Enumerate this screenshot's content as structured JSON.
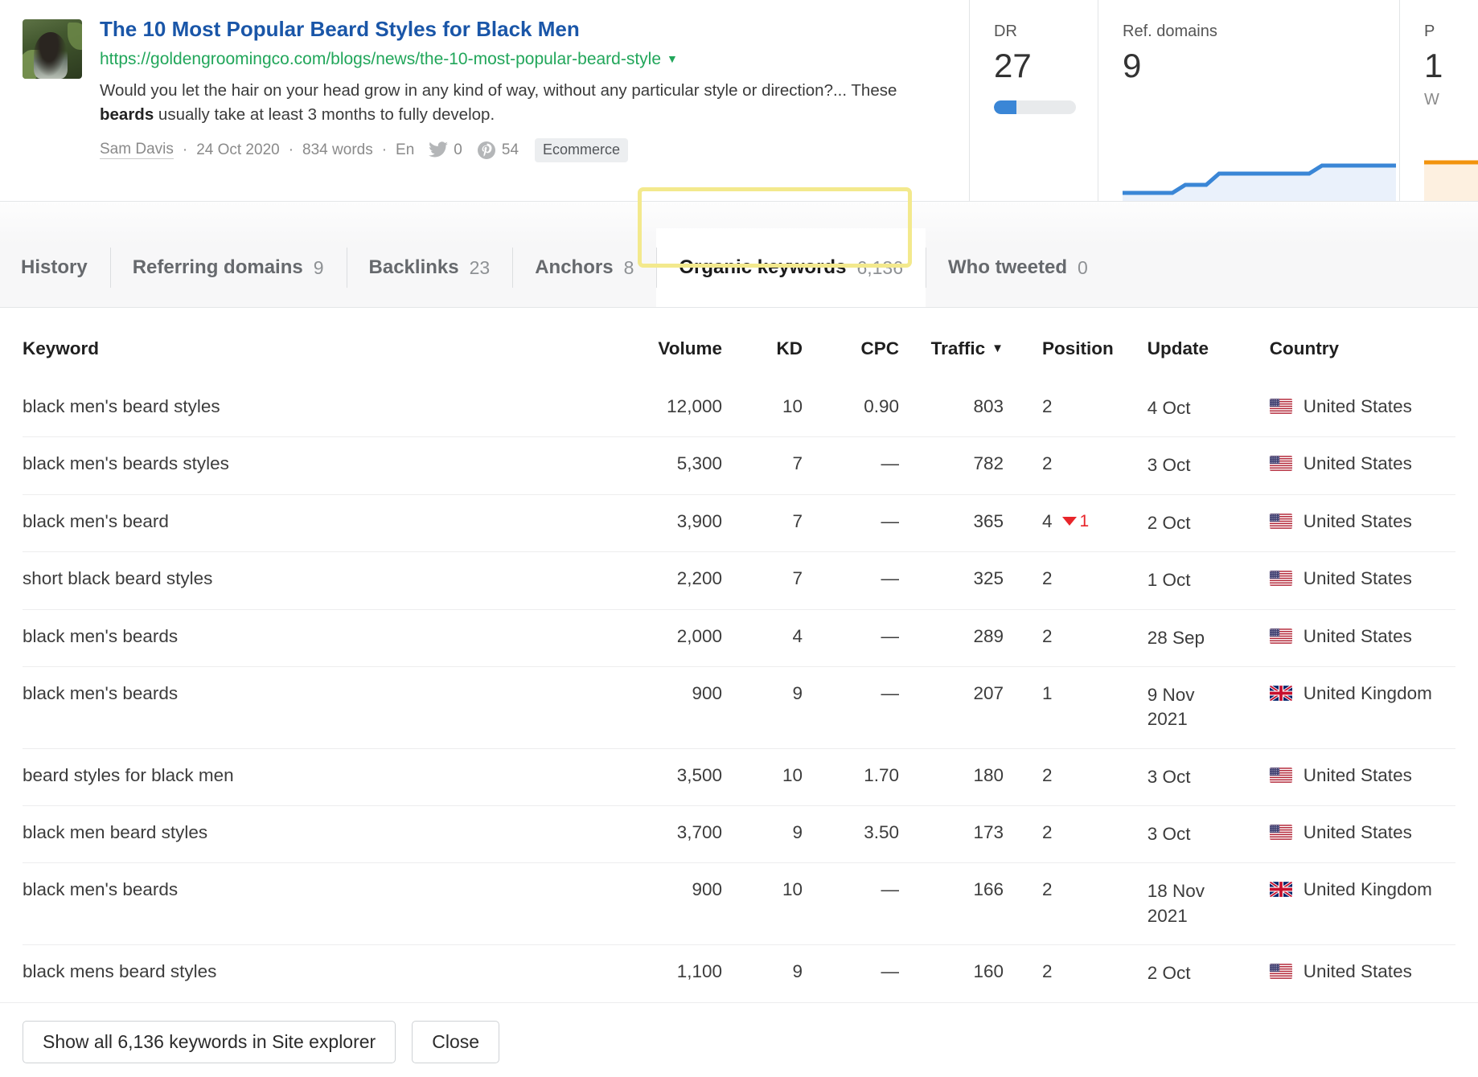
{
  "result": {
    "title": "The 10 Most Popular Beard Styles for Black Men",
    "url": "https://goldengroomingco.com/blogs/news/the-10-most-popular-beard-style",
    "snippet_pre": "Would you let the hair on your head grow in any kind of way, without any particular style or direction?... These ",
    "snippet_bold": "beards",
    "snippet_post": " usually take at least 3 months to fully develop.",
    "author": "Sam Davis",
    "date": "24 Oct 2020",
    "words": "834 words",
    "language": "En",
    "twitter_count": "0",
    "pinterest_count": "54",
    "tag": "Ecommerce",
    "link_color": "#1a56a8",
    "url_color": "#21a65a"
  },
  "metrics": {
    "dr": {
      "label": "DR",
      "value": "27",
      "bar_percent": 27,
      "bar_color": "#3a86d6"
    },
    "ref_domains": {
      "label": "Ref. domains",
      "value": "9",
      "line_color": "#3a86d6"
    },
    "page_keywords": {
      "label": "P",
      "value": "1",
      "sub": "W",
      "line_color": "#f2930d"
    }
  },
  "tabs": [
    {
      "label": "History",
      "count": "",
      "active": false,
      "highlighted": false
    },
    {
      "label": "Referring domains",
      "count": "9",
      "active": false,
      "highlighted": false
    },
    {
      "label": "Backlinks",
      "count": "23",
      "active": false,
      "highlighted": false
    },
    {
      "label": "Anchors",
      "count": "8",
      "active": false,
      "highlighted": false
    },
    {
      "label": "Organic keywords",
      "count": "6,136",
      "active": true,
      "highlighted": true
    },
    {
      "label": "Who tweeted",
      "count": "0",
      "active": false,
      "highlighted": false
    }
  ],
  "highlight_color": "#f3e98d",
  "table": {
    "columns": [
      {
        "key": "keyword",
        "label": "Keyword",
        "align": "left",
        "sorted": false
      },
      {
        "key": "volume",
        "label": "Volume",
        "align": "right",
        "sorted": false
      },
      {
        "key": "kd",
        "label": "KD",
        "align": "right",
        "sorted": false
      },
      {
        "key": "cpc",
        "label": "CPC",
        "align": "right",
        "sorted": false
      },
      {
        "key": "traffic",
        "label": "Traffic",
        "align": "right",
        "sorted": true
      },
      {
        "key": "position",
        "label": "Position",
        "align": "left",
        "sorted": false
      },
      {
        "key": "update",
        "label": "Update",
        "align": "left",
        "sorted": false
      },
      {
        "key": "country",
        "label": "Country",
        "align": "left",
        "sorted": false
      }
    ],
    "sort_caret": "▼",
    "rows": [
      {
        "keyword": "black men's beard styles",
        "volume": "12,000",
        "kd": "10",
        "cpc": "0.90",
        "traffic": "803",
        "position": "2",
        "delta": "",
        "update": "4 Oct",
        "country": "United States",
        "flag": "us"
      },
      {
        "keyword": "black men's beards styles",
        "volume": "5,300",
        "kd": "7",
        "cpc": "—",
        "traffic": "782",
        "position": "2",
        "delta": "",
        "update": "3 Oct",
        "country": "United States",
        "flag": "us"
      },
      {
        "keyword": "black men's beard",
        "volume": "3,900",
        "kd": "7",
        "cpc": "—",
        "traffic": "365",
        "position": "4",
        "delta": "1",
        "update": "2 Oct",
        "country": "United States",
        "flag": "us"
      },
      {
        "keyword": "short black beard styles",
        "volume": "2,200",
        "kd": "7",
        "cpc": "—",
        "traffic": "325",
        "position": "2",
        "delta": "",
        "update": "1 Oct",
        "country": "United States",
        "flag": "us"
      },
      {
        "keyword": "black men's beards",
        "volume": "2,000",
        "kd": "4",
        "cpc": "—",
        "traffic": "289",
        "position": "2",
        "delta": "",
        "update": "28 Sep",
        "country": "United States",
        "flag": "us"
      },
      {
        "keyword": "black men's beards",
        "volume": "900",
        "kd": "9",
        "cpc": "—",
        "traffic": "207",
        "position": "1",
        "delta": "",
        "update": "9 Nov 2021",
        "country": "United Kingdom",
        "flag": "uk"
      },
      {
        "keyword": "beard styles for black men",
        "volume": "3,500",
        "kd": "10",
        "cpc": "1.70",
        "traffic": "180",
        "position": "2",
        "delta": "",
        "update": "3 Oct",
        "country": "United States",
        "flag": "us"
      },
      {
        "keyword": "black men beard styles",
        "volume": "3,700",
        "kd": "9",
        "cpc": "3.50",
        "traffic": "173",
        "position": "2",
        "delta": "",
        "update": "3 Oct",
        "country": "United States",
        "flag": "us"
      },
      {
        "keyword": "black men's beards",
        "volume": "900",
        "kd": "10",
        "cpc": "—",
        "traffic": "166",
        "position": "2",
        "delta": "",
        "update": "18 Nov 2021",
        "country": "United Kingdom",
        "flag": "uk"
      },
      {
        "keyword": "black mens beard styles",
        "volume": "1,100",
        "kd": "9",
        "cpc": "—",
        "traffic": "160",
        "position": "2",
        "delta": "",
        "update": "2 Oct",
        "country": "United States",
        "flag": "us"
      }
    ]
  },
  "footer": {
    "show_all_label": "Show all 6,136 keywords in Site explorer",
    "close_label": "Close"
  }
}
